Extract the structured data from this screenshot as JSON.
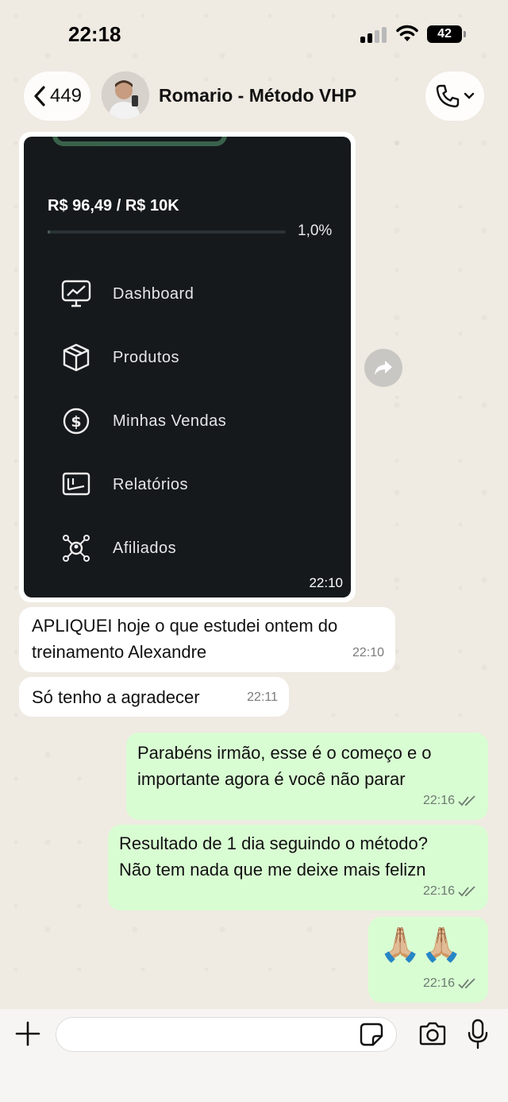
{
  "status_bar": {
    "time": "22:18",
    "battery": "42"
  },
  "header": {
    "back_count": "449",
    "contact_name": "Romario - Método VHP"
  },
  "image_message": {
    "balance": "R$ 96,49 / R$ 10K",
    "progress_label": "1,0%",
    "progress_fraction": 0.01,
    "menu": [
      {
        "label": "Dashboard",
        "icon": "chart-monitor-icon"
      },
      {
        "label": "Produtos",
        "icon": "box-icon"
      },
      {
        "label": "Minhas Vendas",
        "icon": "dollar-circle-icon"
      },
      {
        "label": "Relatórios",
        "icon": "report-icon"
      },
      {
        "label": "Afiliados",
        "icon": "network-icon"
      }
    ],
    "time": "22:10"
  },
  "messages": [
    {
      "direction": "in",
      "text_lines": [
        "APLIQUEI hoje o que estudei ontem do",
        "treinamento Alexandre"
      ],
      "time": "22:10"
    },
    {
      "direction": "in",
      "text_lines": [
        "Só tenho a agradecer"
      ],
      "time": "22:11"
    },
    {
      "direction": "out",
      "text_lines": [
        "Parabéns irmão, esse é o começo e o",
        "importante agora é você não parar"
      ],
      "time": "22:16"
    },
    {
      "direction": "out",
      "text_lines": [
        "Resultado de 1 dia seguindo o método?",
        "Não tem nada que me deixe mais felizn"
      ],
      "time": "22:16"
    },
    {
      "direction": "out",
      "text_lines": [
        "🙏🏼🙏🏼"
      ],
      "time": "22:16"
    }
  ],
  "composer": {
    "placeholder": ""
  },
  "colors": {
    "incoming": "#ffffff",
    "outgoing": "#d9fdd3",
    "wallpaper": "#efeae2"
  }
}
